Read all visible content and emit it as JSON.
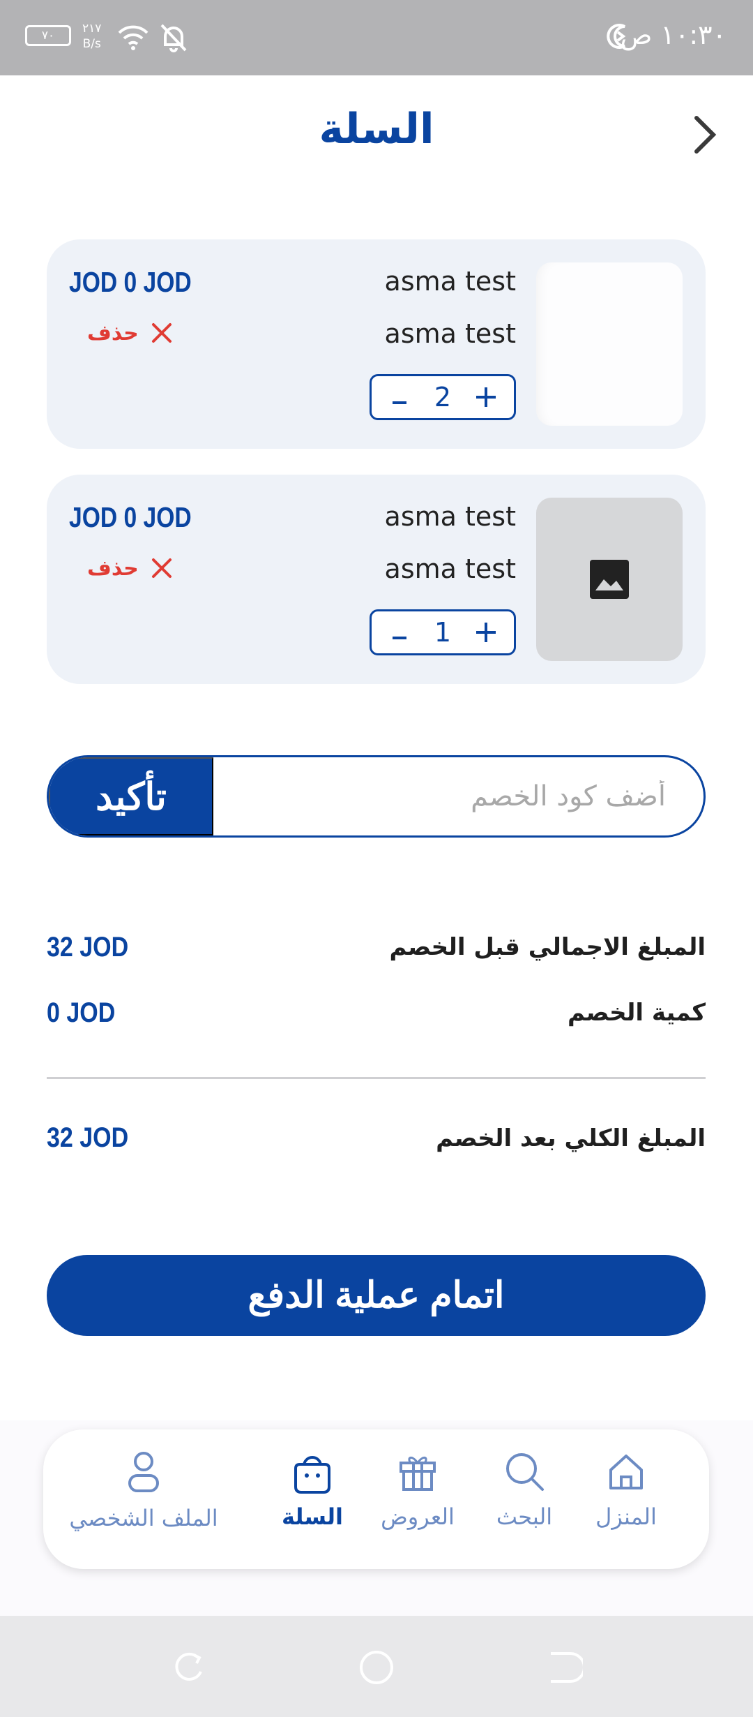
{
  "status_bar": {
    "time": "١٠:٣٠ ص",
    "battery": "٧٠",
    "network_speed_value": "٢١٧",
    "network_speed_unit": "B/s"
  },
  "header": {
    "title": "السلة"
  },
  "cart": {
    "items": [
      {
        "name": "asma test",
        "subtitle": "asma test",
        "price": "JOD 0 JOD",
        "delete_label": "حذف",
        "quantity": "2",
        "image": "blank"
      },
      {
        "name": "asma test",
        "subtitle": "asma test",
        "price": "JOD 0 JOD",
        "delete_label": "حذف",
        "quantity": "1",
        "image": "image-placeholder-icon"
      }
    ]
  },
  "coupon": {
    "placeholder": "أضف كود الخصم",
    "value": "",
    "button_label": "تأكيد"
  },
  "summary": {
    "subtotal_label": "المبلغ الاجمالي قبل الخصم",
    "subtotal_value": "32 JOD",
    "discount_label": "كمية الخصم",
    "discount_value": "0 JOD",
    "total_label": "المبلغ الكلي بعد الخصم",
    "total_value": "32 JOD"
  },
  "checkout": {
    "label": "اتمام عملية الدفع"
  },
  "bottom_nav": {
    "items": [
      {
        "label": "المنزل",
        "icon": "home-icon"
      },
      {
        "label": "البحث",
        "icon": "search-icon"
      },
      {
        "label": "العروض",
        "icon": "gift-icon"
      },
      {
        "label": "السلة",
        "icon": "bag-icon",
        "active": true
      },
      {
        "label": "الملف الشخصي",
        "icon": "profile-icon"
      }
    ]
  },
  "colors": {
    "primary": "#0a44a0",
    "danger": "#e03b33",
    "card_background": "#eef2f8",
    "nav_inactive": "#6c8bc3"
  }
}
